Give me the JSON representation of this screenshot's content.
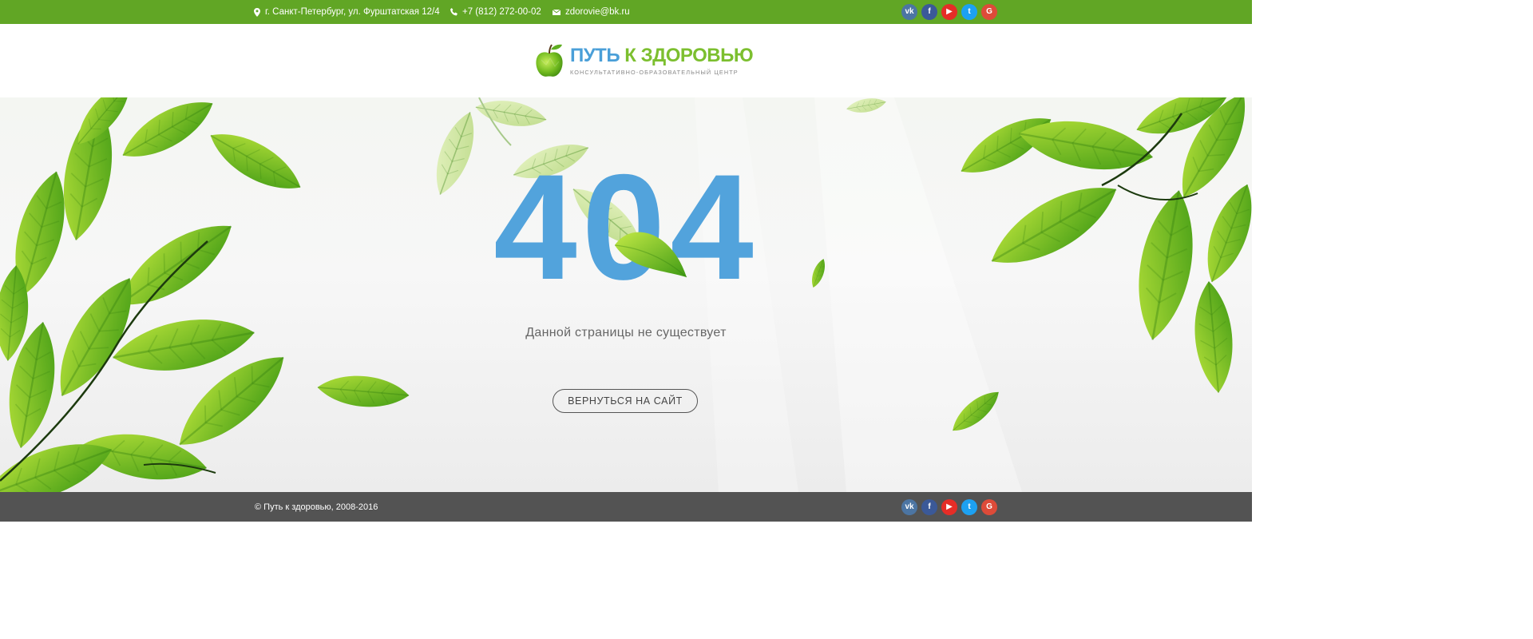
{
  "topbar": {
    "address": "г. Санкт-Петербург, ул. Фурштатская 12/4",
    "phone": "+7 (812) 272-00-02",
    "email": "zdorovie@bk.ru"
  },
  "social": [
    {
      "name": "vk",
      "glyph": "vk",
      "color": "#4c75a3"
    },
    {
      "name": "facebook",
      "glyph": "f",
      "color": "#3b5998"
    },
    {
      "name": "youtube",
      "glyph": "▶",
      "color": "#e52d27"
    },
    {
      "name": "twitter",
      "glyph": "t",
      "color": "#1da1f2"
    },
    {
      "name": "google-plus",
      "glyph": "G",
      "color": "#dd4b39"
    }
  ],
  "logo": {
    "title_part1": "ПУТЬ",
    "title_part2": "К ЗДОРОВЬЮ",
    "subtitle": "КОНСУЛЬТАТИВНО-ОБРАЗОВАТЕЛЬНЫЙ ЦЕНТР",
    "icon": "apple-icon"
  },
  "error": {
    "code": "404",
    "message": "Данной страницы не существует",
    "button_label": "ВЕРНУТЬСЯ НА САЙТ"
  },
  "footer": {
    "copyright": "© Путь к здоровью, 2008-2016"
  },
  "colors": {
    "topbar": "#61a625",
    "footer": "#535353",
    "error_code": "#52a3dc",
    "leaf": "#7cc22a"
  }
}
